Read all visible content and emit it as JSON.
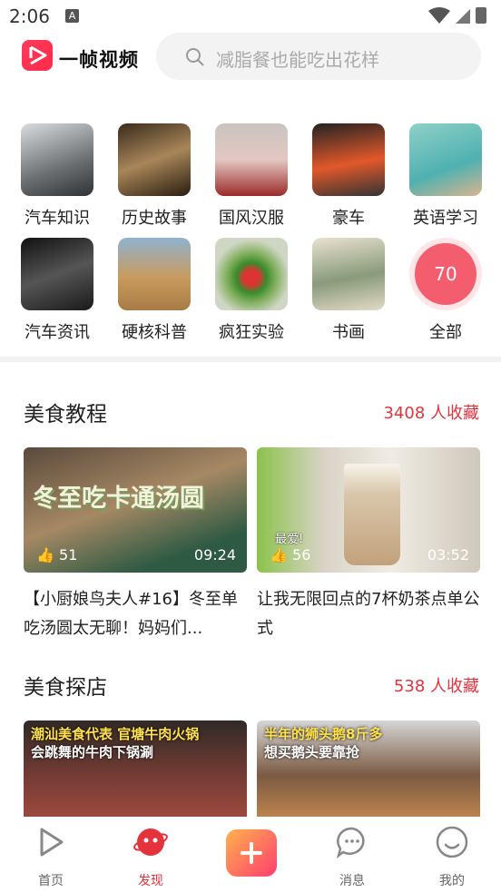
{
  "status": {
    "time": "2:06",
    "indicator": "A"
  },
  "header": {
    "logo_text": "一帧视频",
    "search_placeholder": "减脂餐也能吃出花样"
  },
  "categories": [
    {
      "label": "汽车知识"
    },
    {
      "label": "历史故事"
    },
    {
      "label": "国风汉服"
    },
    {
      "label": "豪车"
    },
    {
      "label": "英语学习"
    },
    {
      "label": "汽车资讯"
    },
    {
      "label": "硬核科普"
    },
    {
      "label": "疯狂实验"
    },
    {
      "label": "书画"
    },
    {
      "label": "全部",
      "count": "70"
    }
  ],
  "section1": {
    "title": "美食教程",
    "count": "3408 人收藏",
    "cards": [
      {
        "thumb_text": "冬至吃卡通汤圆",
        "likes": "51",
        "duration": "09:24",
        "title": "【小厨娘鸟夫人#16】冬至单吃汤圆太无聊！妈妈们..."
      },
      {
        "thumb_text": "最爱!",
        "likes": "56",
        "duration": "03:52",
        "title": "让我无限回点的7杯奶茶点单公式"
      }
    ]
  },
  "section2": {
    "title": "美食探店",
    "count": "538 人收藏",
    "cards": [
      {
        "caption1": "潮汕美食代表 官塘牛肉火锅",
        "caption2": "会跳舞的牛肉下锅涮"
      },
      {
        "caption1": "半年的狮头鹅8斤多",
        "caption2": "想买鹅头要靠抢"
      }
    ]
  },
  "tabbar": {
    "items": [
      {
        "label": "首页"
      },
      {
        "label": "发现"
      },
      {
        "label": "消息"
      },
      {
        "label": "我的"
      }
    ]
  },
  "colors": {
    "accent": "#e4333c",
    "plus_gradient_start": "#ffb24d",
    "plus_gradient_end": "#ff3d6e"
  }
}
